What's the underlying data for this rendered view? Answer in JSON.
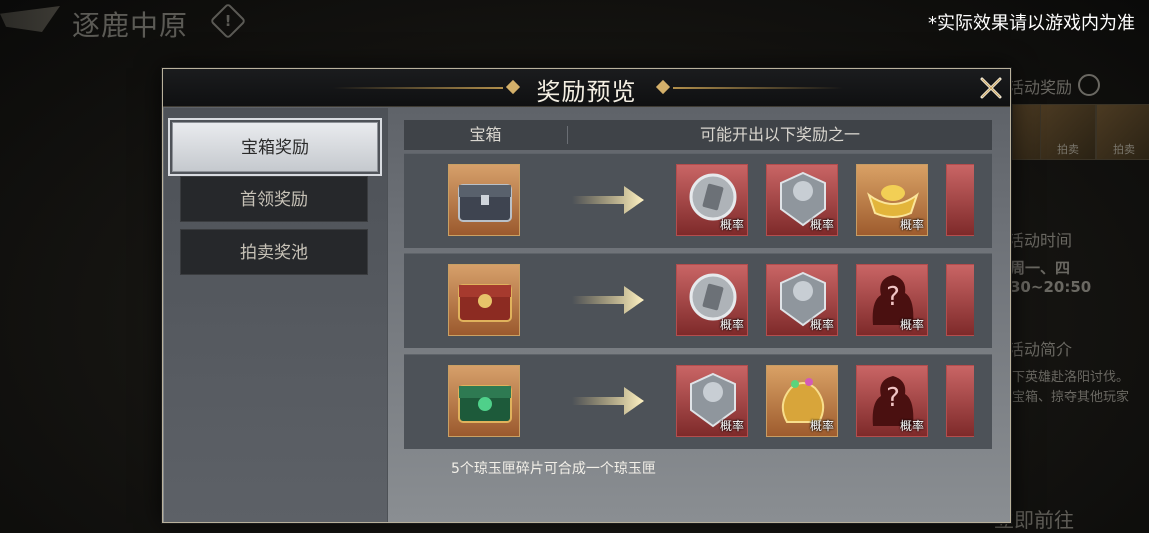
{
  "background": {
    "title": "逐鹿中原",
    "info_symbol": "!",
    "side_rewards_label": "活动奖励",
    "side_thumb_1": "",
    "side_thumb_2": "拍卖",
    "side_thumb_3": "拍卖",
    "side_time_label": "活动时间",
    "side_time_days": "周一、四",
    "side_time_range": "30~20:50",
    "side_intro_label": "活动简介",
    "side_intro_line1": "下英雄赴洛阳讨伐。",
    "side_intro_line2": "宝箱、掠夺其他玩家",
    "go_button": "立即前往"
  },
  "disclaimer": "*实际效果请以游戏内为准",
  "modal": {
    "title": "奖励预览",
    "tabs": [
      {
        "label": "宝箱奖励",
        "active": true
      },
      {
        "label": "首领奖励",
        "active": false
      },
      {
        "label": "拍卖奖池",
        "active": false
      }
    ],
    "table_headers": {
      "chest": "宝箱",
      "rewards": "可能开出以下奖励之一"
    },
    "rows": [
      {
        "chest": "silver-chest-icon",
        "items": [
          {
            "icon": "silver-token-icon",
            "label": "概率"
          },
          {
            "icon": "silver-badge-icon",
            "label": "概率"
          },
          {
            "icon": "gold-ingot-icon",
            "label": "概率",
            "gold": true
          }
        ]
      },
      {
        "chest": "red-chest-icon",
        "items": [
          {
            "icon": "silver-token-icon",
            "label": "概率"
          },
          {
            "icon": "silver-badge-icon",
            "label": "概率"
          },
          {
            "icon": "mystery-silhouette-icon",
            "label": "概率"
          }
        ]
      },
      {
        "chest": "jade-chest-icon",
        "items": [
          {
            "icon": "silver-badge-icon",
            "label": "概率"
          },
          {
            "icon": "gold-pouch-icon",
            "label": "概率",
            "gold": true
          },
          {
            "icon": "mystery-silhouette-icon",
            "label": "概率"
          }
        ]
      }
    ],
    "footnote": "5个琼玉匣碎片可合成一个琼玉匣"
  }
}
